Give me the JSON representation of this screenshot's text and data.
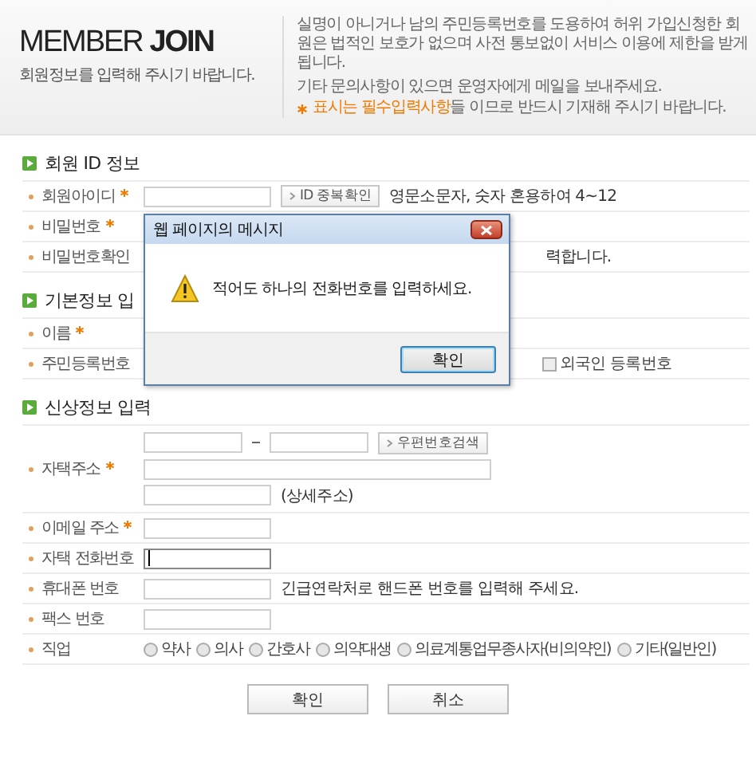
{
  "header": {
    "title_light": "MEMBER",
    "title_bold": "JOIN",
    "subtitle": "회원정보를 입력해 주시기 바랍니다.",
    "notice": "실명이 아니거나 남의 주민등록번호를 도용하여 허위 가입신청한 회원은 법적인 보호가 없으며 사전 통보없이 서비스 이용에 제한을 받게 됩니다.",
    "contact": "기타 문의사항이 있으면 운영자에게 메일을 보내주세요.",
    "required_highlight": "표시는 필수입력사항",
    "required_rest": "들 이므로 반드시 기재해 주시기 바랍니다."
  },
  "sections": [
    {
      "title": "회원 ID 정보",
      "rows": [
        {
          "kind": "field_button",
          "label": "회원아이디",
          "required": true,
          "focused": false,
          "button": "ID 중복확인",
          "hint": "영문소문자, 숫자 혼용하여 4~12"
        },
        {
          "kind": "covered",
          "label": "비밀번호",
          "required": true
        },
        {
          "kind": "covered_hint",
          "label": "비밀번호확인",
          "required": false,
          "hint": "력합니다."
        }
      ]
    },
    {
      "title": "기본정보 입",
      "rows": [
        {
          "kind": "covered",
          "label": "이름",
          "required": true
        },
        {
          "kind": "covered_check",
          "label": "주민등록번호",
          "required": false,
          "check": {
            "label": "외국인 등록번호",
            "checked": false
          }
        }
      ]
    },
    {
      "title": "신상정보 입력",
      "rows": [
        {
          "kind": "address",
          "label": "자택주소",
          "required": true,
          "button": "우편번호검색",
          "detail_hint": "(상세주소)"
        },
        {
          "kind": "field",
          "label": "이메일 주소",
          "required": true,
          "focused": false
        },
        {
          "kind": "field",
          "label": "자택 전화번호",
          "required": false,
          "focused": true
        },
        {
          "kind": "field_hint",
          "label": "휴대폰 번호",
          "required": false,
          "focused": false,
          "hint": "긴급연락처로 핸드폰 번호를 입력해 주세요."
        },
        {
          "kind": "field",
          "label": "팩스 번호",
          "required": false,
          "focused": false
        },
        {
          "kind": "radio",
          "label": "직업",
          "required": false,
          "options": [
            {
              "label": "약사",
              "selected": false
            },
            {
              "label": "의사",
              "selected": false
            },
            {
              "label": "간호사",
              "selected": false
            },
            {
              "label": "의약대생",
              "selected": false
            },
            {
              "label": "의료계통업무종사자(비의약인)",
              "selected": false
            },
            {
              "label": "기타(일반인)",
              "selected": false
            }
          ]
        }
      ]
    }
  ],
  "buttons": [
    "확인",
    "취소"
  ],
  "dialog": {
    "title": "웹 페이지의 메시지",
    "message": "적어도 하나의 전화번호를 입력하세요.",
    "button": "확인"
  }
}
